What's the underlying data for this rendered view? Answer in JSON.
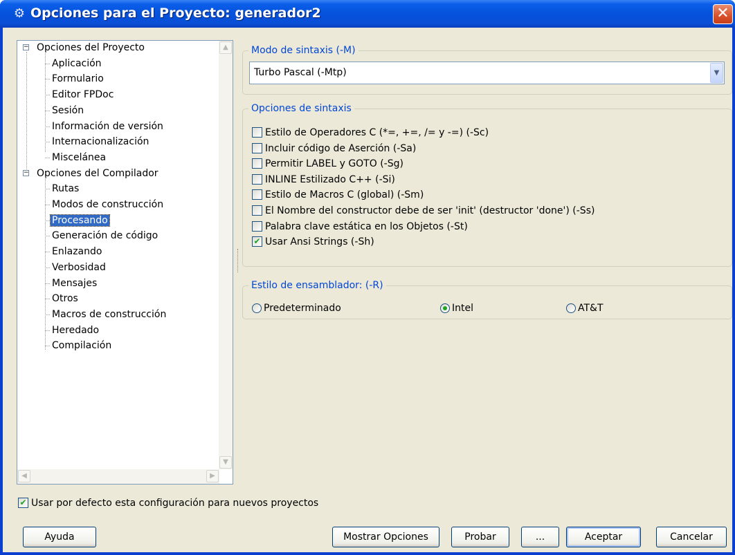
{
  "window": {
    "title": "Opciones para el Proyecto: generador2",
    "icon": "gear-icon"
  },
  "tree": {
    "items": [
      {
        "label": "Opciones del Proyecto",
        "level": 0,
        "expander": "−"
      },
      {
        "label": "Aplicación",
        "level": 1
      },
      {
        "label": "Formulario",
        "level": 1
      },
      {
        "label": "Editor FPDoc",
        "level": 1
      },
      {
        "label": "Sesión",
        "level": 1
      },
      {
        "label": "Información de versión",
        "level": 1
      },
      {
        "label": "Internacionalización",
        "level": 1
      },
      {
        "label": "Miscelánea",
        "level": 1
      },
      {
        "label": "Opciones del Compilador",
        "level": 0,
        "expander": "−"
      },
      {
        "label": "Rutas",
        "level": 1
      },
      {
        "label": "Modos de construcción",
        "level": 1
      },
      {
        "label": "Procesando",
        "level": 1,
        "selected": true
      },
      {
        "label": "Generación de código",
        "level": 1
      },
      {
        "label": "Enlazando",
        "level": 1
      },
      {
        "label": "Verbosidad",
        "level": 1
      },
      {
        "label": "Mensajes",
        "level": 1
      },
      {
        "label": "Otros",
        "level": 1
      },
      {
        "label": "Macros de construcción",
        "level": 1
      },
      {
        "label": "Heredado",
        "level": 1
      },
      {
        "label": "Compilación",
        "level": 1
      }
    ]
  },
  "syntax_mode": {
    "title": "Modo de sintaxis (-M)",
    "selected": "Turbo Pascal (-Mtp)"
  },
  "syntax_options": {
    "title": "Opciones de sintaxis",
    "items": [
      {
        "label": "Estilo de Operadores C (*=, +=, /= y -=) (-Sc)",
        "checked": false
      },
      {
        "label": "Incluir código de Aserción (-Sa)",
        "checked": false
      },
      {
        "label": "Permitir LABEL y GOTO (-Sg)",
        "checked": false
      },
      {
        "label": "INLINE Estilizado C++ (-Si)",
        "checked": false
      },
      {
        "label": "Estilo de Macros C (global) (-Sm)",
        "checked": false
      },
      {
        "label": "El Nombre del constructor debe de ser 'init' (destructor 'done') (-Ss)",
        "checked": false
      },
      {
        "label": "Palabra clave estática en los Objetos (-St)",
        "checked": false
      },
      {
        "label": "Usar Ansi Strings (-Sh)",
        "checked": true
      }
    ]
  },
  "assembler": {
    "title": "Estilo de ensamblador: (-R)",
    "options": [
      {
        "label": "Predeterminado",
        "selected": false
      },
      {
        "label": "Intel",
        "selected": true
      },
      {
        "label": "AT&T",
        "selected": false
      }
    ]
  },
  "default_config": {
    "label": "Usar por defecto esta configuración para nuevos proyectos",
    "checked": true
  },
  "buttons": {
    "help": "Ayuda",
    "show_options": "Mostrar Opciones",
    "test": "Probar",
    "more": "...",
    "accept": "Aceptar",
    "cancel": "Cancelar"
  }
}
